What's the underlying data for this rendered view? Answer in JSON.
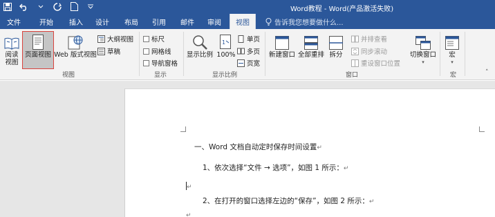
{
  "window": {
    "title": "Word教程 - Word(产品激活失败)"
  },
  "tabs": [
    "文件",
    "开始",
    "插入",
    "设计",
    "布局",
    "引用",
    "邮件",
    "审阅",
    "视图"
  ],
  "active_tab": "视图",
  "tell_me": {
    "placeholder": "告诉我您想要做什么..."
  },
  "ribbon": {
    "views": {
      "read_mode": "阅读\n视图",
      "print_layout": "页面视图",
      "web_layout": "Web 版式视图",
      "outline": "大纲视图",
      "draft": "草稿",
      "label": "视图"
    },
    "show": {
      "ruler": "标尺",
      "gridlines": "网格线",
      "nav_pane": "导航窗格",
      "label": "显示"
    },
    "zoom": {
      "zoom": "显示比例",
      "percent": "100%",
      "one_page": "单页",
      "multi_page": "多页",
      "page_width": "页宽",
      "label": "显示比例"
    },
    "window": {
      "new_window": "新建窗口",
      "arrange_all": "全部重排",
      "split": "拆分",
      "side_by_side": "并排查看",
      "sync_scroll": "同步滚动",
      "reset_pos": "重设窗口位置",
      "switch": "切换窗口",
      "label": "窗口"
    },
    "macros": {
      "macros": "宏",
      "label": "宏"
    }
  },
  "document": {
    "lines": [
      "一、Word 文档自动定时保存时间设置",
      "1、依次选择“文件 → 选项”，如图 1 所示：",
      "",
      "2、在打开的窗口选择左边的“保存”，如图 2 所示："
    ]
  },
  "colors": {
    "title_bar": "#2b579a",
    "ribbon": "#f3f3f3",
    "doc_bg": "#e6e6e6"
  }
}
